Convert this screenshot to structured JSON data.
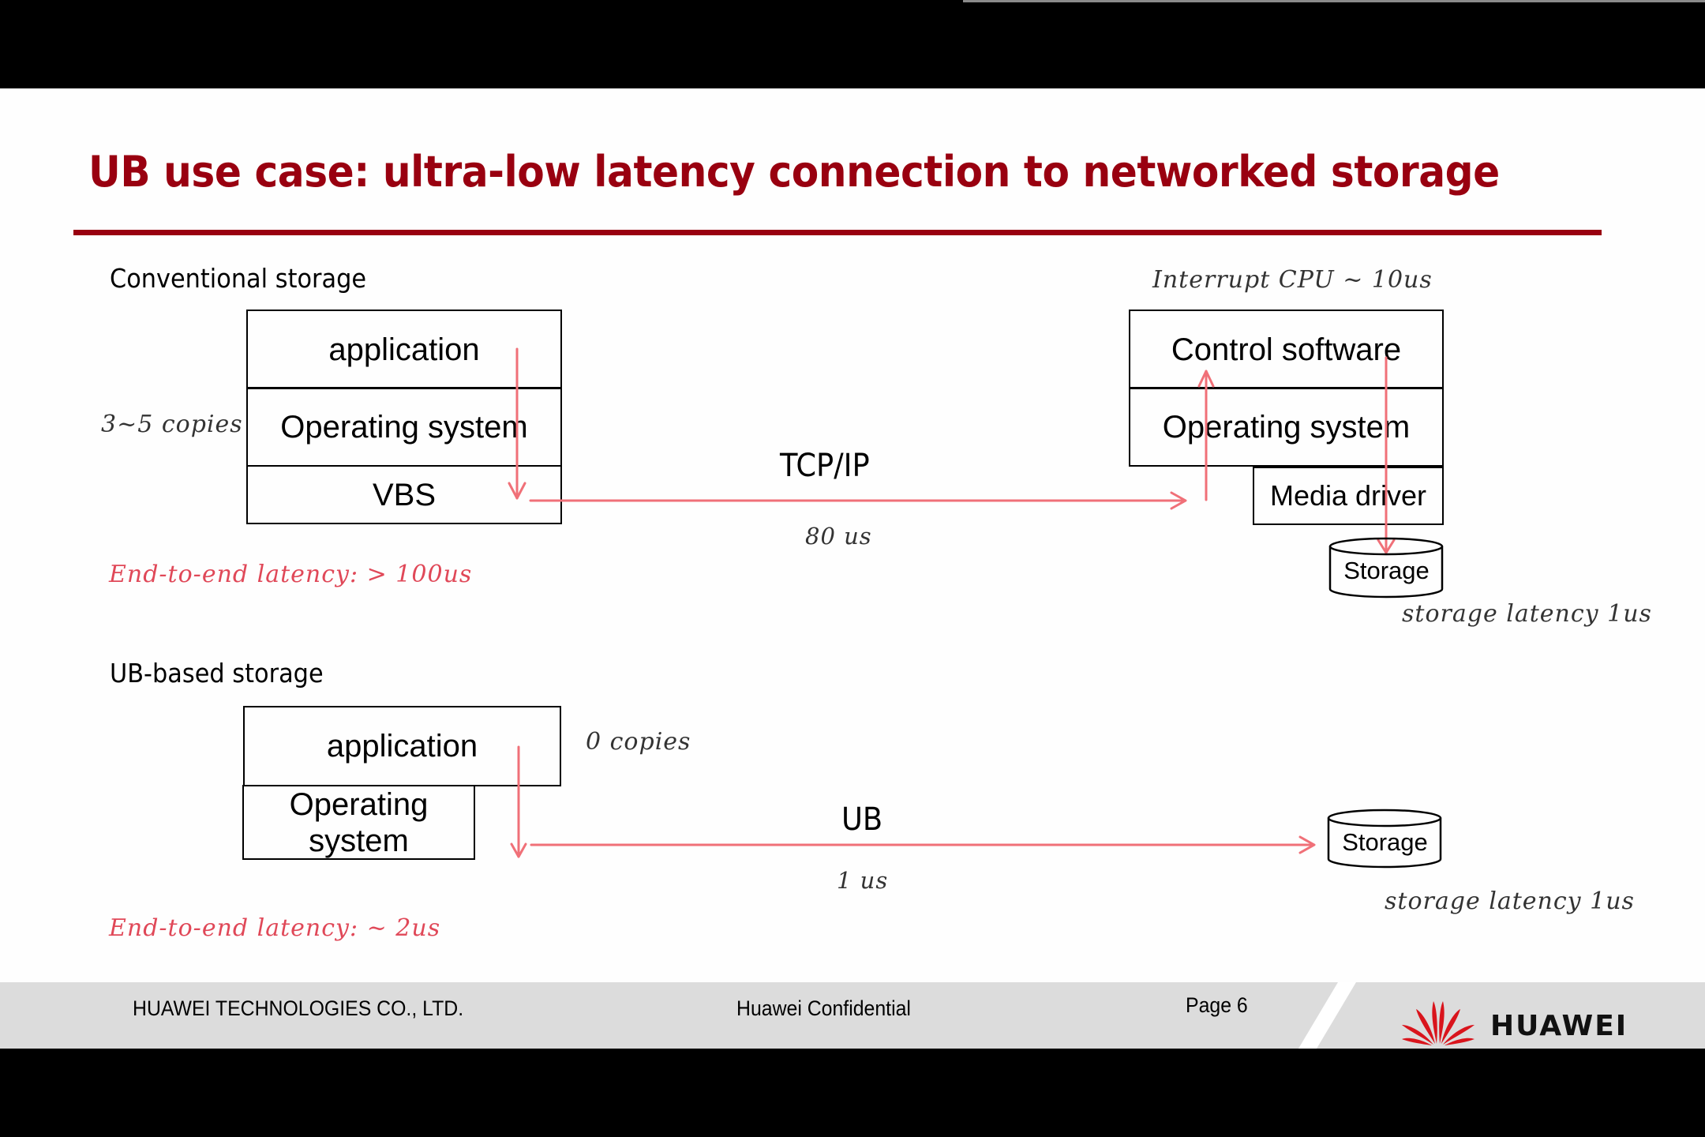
{
  "slide": {
    "title": "UB use case: ultra-low latency connection to networked storage",
    "colors": {
      "title_red": "#990010",
      "arrow_red": "#f07078",
      "annotation_red": "#e04858",
      "footer_gray": "#dcdcdc"
    }
  },
  "conventional": {
    "label": "Conventional storage",
    "client_stack": [
      "application",
      "Operating system",
      "VBS"
    ],
    "copies_note": "3~5 copies",
    "network_label": "TCP/IP",
    "network_latency": "80 us",
    "server_note": "Interrupt CPU ~ 10us",
    "server_stack": [
      "Control software",
      "Operating system"
    ],
    "media_driver": "Media driver",
    "storage": "Storage",
    "storage_latency": "storage latency 1us",
    "end_to_end": "End-to-end latency: > 100us"
  },
  "ub": {
    "label": "UB-based storage",
    "application": "application",
    "os": "Operating system",
    "copies_note": "0 copies",
    "network_label": "UB",
    "network_latency": "1 us",
    "storage": "Storage",
    "storage_latency": "storage latency 1us",
    "end_to_end": "End-to-end latency: ~ 2us"
  },
  "footer": {
    "company": "HUAWEI TECHNOLOGIES CO., LTD.",
    "confidential": "Huawei Confidential",
    "page": "Page 6",
    "logo_text": "HUAWEI",
    "logo_icon": "huawei-petal-logo"
  }
}
